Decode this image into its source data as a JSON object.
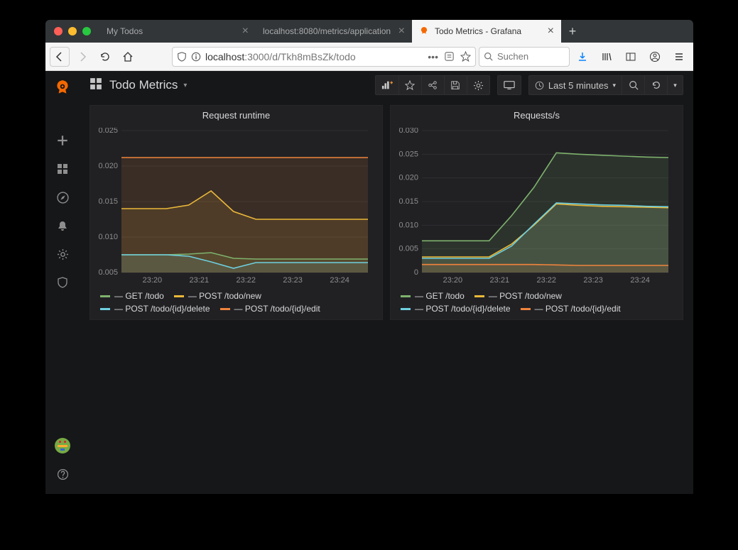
{
  "browser": {
    "tabs": [
      {
        "label": "My Todos",
        "active": false
      },
      {
        "label": "localhost:8080/metrics/application",
        "active": false
      },
      {
        "label": "Todo Metrics - Grafana",
        "active": true
      }
    ],
    "url_prefix": "localhost",
    "url_rest": ":3000/d/Tkh8mBsZk/todo",
    "search_placeholder": "Suchen"
  },
  "dashboard": {
    "title": "Todo Metrics",
    "time_range": "Last 5 minutes"
  },
  "colors": {
    "green": "#7eb26d",
    "yellow": "#eab839",
    "cyan": "#6ed0e0",
    "orange": "#ef843c"
  },
  "chart_data": [
    {
      "type": "line",
      "title": "Request runtime",
      "xlabel": "",
      "ylabel": "",
      "ylim": [
        0.005,
        0.025
      ],
      "x_ticks": [
        "23:20",
        "23:21",
        "23:22",
        "23:23",
        "23:24"
      ],
      "y_ticks": [
        0.005,
        0.01,
        0.015,
        0.02,
        0.025
      ],
      "categories": [
        "23:19.5",
        "23:20",
        "23:20.5",
        "23:21",
        "23:21.2",
        "23:21.5",
        "23:22",
        "23:22.5",
        "23:23",
        "23:23.5",
        "23:24",
        "23:24.5"
      ],
      "series": [
        {
          "name": "GET /todo",
          "color": "green",
          "values": [
            0.0075,
            0.0075,
            0.0075,
            0.0076,
            0.0078,
            0.007,
            0.0069,
            0.0069,
            0.0069,
            0.0069,
            0.0069,
            0.0069
          ]
        },
        {
          "name": "POST /todo/new",
          "color": "yellow",
          "values": [
            0.014,
            0.014,
            0.014,
            0.0145,
            0.0165,
            0.0136,
            0.0125,
            0.0125,
            0.0125,
            0.0125,
            0.0125,
            0.0125
          ]
        },
        {
          "name": "POST /todo/{id}/delete",
          "color": "cyan",
          "values": [
            0.0075,
            0.0075,
            0.0075,
            0.0073,
            0.0065,
            0.0056,
            0.0064,
            0.0064,
            0.0064,
            0.0064,
            0.0064,
            0.0064
          ]
        },
        {
          "name": "POST /todo/{id}/edit",
          "color": "orange",
          "values": [
            0.0212,
            0.0212,
            0.0212,
            0.0212,
            0.0212,
            0.0212,
            0.0212,
            0.0212,
            0.0212,
            0.0212,
            0.0212,
            0.0212
          ]
        }
      ],
      "fill": true
    },
    {
      "type": "line",
      "title": "Requests/s",
      "xlabel": "",
      "ylabel": "",
      "ylim": [
        0,
        0.03
      ],
      "x_ticks": [
        "23:20",
        "23:21",
        "23:22",
        "23:23",
        "23:24"
      ],
      "y_ticks": [
        0,
        0.005,
        0.01,
        0.015,
        0.02,
        0.025,
        0.03
      ],
      "categories": [
        "23:19.5",
        "23:20",
        "23:20.5",
        "23:21",
        "23:21.3",
        "23:21.6",
        "23:22",
        "23:22.5",
        "23:23",
        "23:23.5",
        "23:24",
        "23:24.5"
      ],
      "series": [
        {
          "name": "GET /todo",
          "color": "green",
          "values": [
            0.0067,
            0.0067,
            0.0067,
            0.0067,
            0.012,
            0.018,
            0.0253,
            0.025,
            0.0248,
            0.0246,
            0.0244,
            0.0243
          ]
        },
        {
          "name": "POST /todo/new",
          "color": "yellow",
          "values": [
            0.0033,
            0.0033,
            0.0033,
            0.0033,
            0.006,
            0.01,
            0.0145,
            0.0142,
            0.014,
            0.0139,
            0.0138,
            0.0137
          ]
        },
        {
          "name": "POST /todo/{id}/delete",
          "color": "cyan",
          "values": [
            0.003,
            0.003,
            0.003,
            0.003,
            0.0056,
            0.0102,
            0.0147,
            0.0145,
            0.0143,
            0.0142,
            0.014,
            0.0139
          ]
        },
        {
          "name": "POST /todo/{id}/edit",
          "color": "orange",
          "values": [
            0.0017,
            0.0017,
            0.0017,
            0.0017,
            0.0017,
            0.0017,
            0.0016,
            0.0015,
            0.0015,
            0.0015,
            0.0015,
            0.0015
          ]
        }
      ],
      "fill": true
    }
  ]
}
